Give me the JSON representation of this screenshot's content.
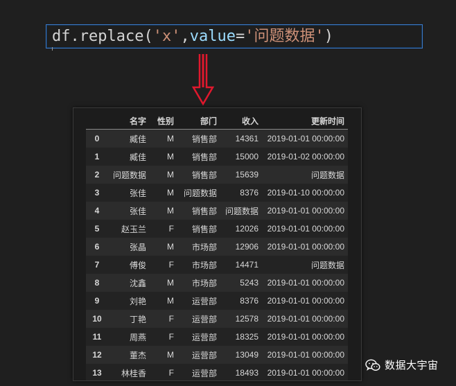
{
  "code": {
    "object": "df",
    "method": "replace",
    "arg1": "'x'",
    "kwarg_name": "value",
    "kwarg_value": "'问题数据'"
  },
  "accent_colors": {
    "cell_border": "#3b78c4",
    "arrow": "#e0182d",
    "string": "#ce9178",
    "keyword": "#9cdcfe"
  },
  "table": {
    "columns": [
      "名字",
      "性别",
      "部门",
      "收入",
      "更新时间"
    ],
    "rows": [
      {
        "index": "0",
        "name": "臧佳",
        "sex": "M",
        "dept": "销售部",
        "income": "14361",
        "time": "2019-01-01 00:00:00"
      },
      {
        "index": "1",
        "name": "臧佳",
        "sex": "M",
        "dept": "销售部",
        "income": "15000",
        "time": "2019-01-02 00:00:00"
      },
      {
        "index": "2",
        "name": "问题数据",
        "sex": "M",
        "dept": "销售部",
        "income": "15639",
        "time": "问题数据"
      },
      {
        "index": "3",
        "name": "张佳",
        "sex": "M",
        "dept": "问题数据",
        "income": "8376",
        "time": "2019-01-10 00:00:00"
      },
      {
        "index": "4",
        "name": "张佳",
        "sex": "M",
        "dept": "销售部",
        "income": "问题数据",
        "time": "2019-01-01 00:00:00"
      },
      {
        "index": "5",
        "name": "赵玉兰",
        "sex": "F",
        "dept": "销售部",
        "income": "12026",
        "time": "2019-01-01 00:00:00"
      },
      {
        "index": "6",
        "name": "张晶",
        "sex": "M",
        "dept": "市场部",
        "income": "12906",
        "time": "2019-01-01 00:00:00"
      },
      {
        "index": "7",
        "name": "傅俊",
        "sex": "F",
        "dept": "市场部",
        "income": "14471",
        "time": "问题数据"
      },
      {
        "index": "8",
        "name": "沈鑫",
        "sex": "M",
        "dept": "市场部",
        "income": "5243",
        "time": "2019-01-01 00:00:00"
      },
      {
        "index": "9",
        "name": "刘艳",
        "sex": "M",
        "dept": "运营部",
        "income": "8376",
        "time": "2019-01-01 00:00:00"
      },
      {
        "index": "10",
        "name": "丁艳",
        "sex": "F",
        "dept": "运营部",
        "income": "12578",
        "time": "2019-01-01 00:00:00"
      },
      {
        "index": "11",
        "name": "周燕",
        "sex": "F",
        "dept": "运营部",
        "income": "18325",
        "time": "2019-01-01 00:00:00"
      },
      {
        "index": "12",
        "name": "董杰",
        "sex": "M",
        "dept": "运营部",
        "income": "13049",
        "time": "2019-01-01 00:00:00"
      },
      {
        "index": "13",
        "name": "林桂香",
        "sex": "F",
        "dept": "运营部",
        "income": "18493",
        "time": "2019-01-01 00:00:00"
      }
    ]
  },
  "watermark": {
    "icon": "wechat-icon",
    "text": "数据大宇宙"
  }
}
